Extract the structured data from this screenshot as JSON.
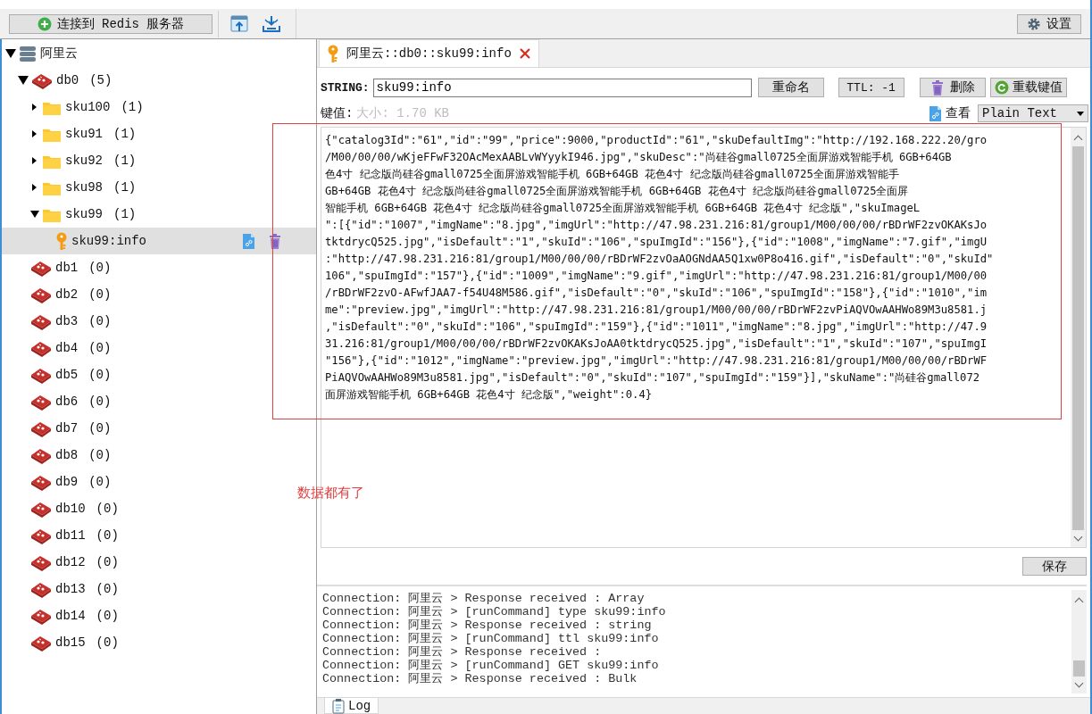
{
  "toolbar": {
    "connect_button": "连接到 Redis 服务器",
    "settings_button": "设置"
  },
  "tree": [
    {
      "label": "阿里云",
      "kind": "server",
      "expanded": true,
      "children": [
        {
          "label": "db0",
          "count": "(5)",
          "kind": "db",
          "expanded": true,
          "children": [
            {
              "label": "sku100",
              "count": "(1)",
              "kind": "folder",
              "expanded": false
            },
            {
              "label": "sku91",
              "count": "(1)",
              "kind": "folder",
              "expanded": false
            },
            {
              "label": "sku92",
              "count": "(1)",
              "kind": "folder",
              "expanded": false
            },
            {
              "label": "sku98",
              "count": "(1)",
              "kind": "folder",
              "expanded": false
            },
            {
              "label": "sku99",
              "count": "(1)",
              "kind": "folder",
              "expanded": true,
              "children": [
                {
                  "label": "sku99:info",
                  "kind": "key",
                  "selected": true
                }
              ]
            }
          ]
        },
        {
          "label": "db1",
          "count": "(0)",
          "kind": "db"
        },
        {
          "label": "db2",
          "count": "(0)",
          "kind": "db"
        },
        {
          "label": "db3",
          "count": "(0)",
          "kind": "db"
        },
        {
          "label": "db4",
          "count": "(0)",
          "kind": "db"
        },
        {
          "label": "db5",
          "count": "(0)",
          "kind": "db"
        },
        {
          "label": "db6",
          "count": "(0)",
          "kind": "db"
        },
        {
          "label": "db7",
          "count": "(0)",
          "kind": "db"
        },
        {
          "label": "db8",
          "count": "(0)",
          "kind": "db"
        },
        {
          "label": "db9",
          "count": "(0)",
          "kind": "db"
        },
        {
          "label": "db10",
          "count": "(0)",
          "kind": "db"
        },
        {
          "label": "db11",
          "count": "(0)",
          "kind": "db"
        },
        {
          "label": "db12",
          "count": "(0)",
          "kind": "db"
        },
        {
          "label": "db13",
          "count": "(0)",
          "kind": "db"
        },
        {
          "label": "db14",
          "count": "(0)",
          "kind": "db"
        },
        {
          "label": "db15",
          "count": "(0)",
          "kind": "db"
        }
      ]
    }
  ],
  "editor": {
    "tab": {
      "title": "阿里云::db0::sku99:info",
      "selected": true
    },
    "type_label": "STRING:",
    "key_name": "sku99:info",
    "rename_button": "重命名",
    "ttl_button": "TTL: -1",
    "delete_button": "删除",
    "reload_button": "重载键值",
    "value_label": "键值:",
    "size": "大小: 1.70 KB",
    "view_label": "查看",
    "view_mode": "Plain Text",
    "value_lines": [
      "{\"catalog3Id\":\"61\",\"id\":\"99\",\"price\":9000,\"productId\":\"61\",\"skuDefaultImg\":\"http://192.168.222.20/gro",
      "/M00/00/00/wKjeFFwF32OAcMexAABLvWYyykI946.jpg\",\"skuDesc\":\"尚硅谷gmall0725全面屏游戏智能手机 6GB+64GB",
      "色4寸 纪念版尚硅谷gmall0725全面屏游戏智能手机 6GB+64GB 花色4寸 纪念版尚硅谷gmall0725全面屏游戏智能手",
      "GB+64GB 花色4寸 纪念版尚硅谷gmall0725全面屏游戏智能手机 6GB+64GB 花色4寸 纪念版尚硅谷gmall0725全面屏",
      "智能手机 6GB+64GB 花色4寸 纪念版尚硅谷gmall0725全面屏游戏智能手机 6GB+64GB 花色4寸 纪念版\",\"skuImageL",
      "\":[{\"id\":\"1007\",\"imgName\":\"8.jpg\",\"imgUrl\":\"http://47.98.231.216:81/group1/M00/00/00/rBDrWF2zvOKAKsJo",
      "tktdrycQ525.jpg\",\"isDefault\":\"1\",\"skuId\":\"106\",\"spuImgId\":\"156\"},{\"id\":\"1008\",\"imgName\":\"7.gif\",\"imgU",
      ":\"http://47.98.231.216:81/group1/M00/00/00/rBDrWF2zvOaAOGNdAA5Q1xw0P8o416.gif\",\"isDefault\":\"0\",\"skuId\"",
      "106\",\"spuImgId\":\"157\"},{\"id\":\"1009\",\"imgName\":\"9.gif\",\"imgUrl\":\"http://47.98.231.216:81/group1/M00/00",
      "/rBDrWF2zvO-AFwfJAA7-f54U48M586.gif\",\"isDefault\":\"0\",\"skuId\":\"106\",\"spuImgId\":\"158\"},{\"id\":\"1010\",\"im",
      "me\":\"preview.jpg\",\"imgUrl\":\"http://47.98.231.216:81/group1/M00/00/00/rBDrWF2zvPiAQVOwAAHWo89M3u8581.j",
      ",\"isDefault\":\"0\",\"skuId\":\"106\",\"spuImgId\":\"159\"},{\"id\":\"1011\",\"imgName\":\"8.jpg\",\"imgUrl\":\"http://47.9",
      "31.216:81/group1/M00/00/00/rBDrWF2zvOKAKsJoAA0tktdrycQ525.jpg\",\"isDefault\":\"1\",\"skuId\":\"107\",\"spuImgI",
      "\"156\"},{\"id\":\"1012\",\"imgName\":\"preview.jpg\",\"imgUrl\":\"http://47.98.231.216:81/group1/M00/00/00/rBDrWF",
      "PiAQVOwAAHWo89M3u8581.jpg\",\"isDefault\":\"0\",\"skuId\":\"107\",\"spuImgId\":\"159\"}],\"skuName\":\"尚硅谷gmall072",
      "面屏游戏智能手机 6GB+64GB 花色4寸 纪念版\",\"weight\":0.4}"
    ],
    "save_button": "保存"
  },
  "log": {
    "lines": [
      "Connection: 阿里云 > Response received : Array",
      "Connection: 阿里云 > [runCommand] type sku99:info",
      "Connection: 阿里云 > Response received : string",
      "Connection: 阿里云 > [runCommand] ttl sku99:info",
      "Connection: 阿里云 > Response received :",
      "Connection: 阿里云 > [runCommand] GET sku99:info",
      "Connection: 阿里云 > Response received : Bulk"
    ],
    "tab": {
      "label": "Log",
      "selected": true
    }
  },
  "annotation": {
    "text": "数据都有了"
  }
}
